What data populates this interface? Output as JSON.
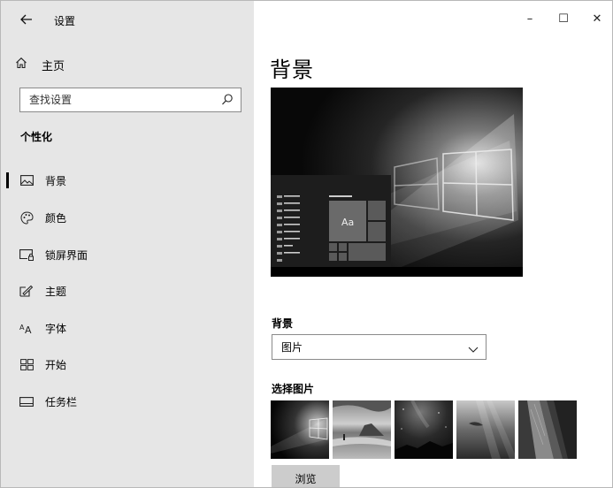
{
  "window": {
    "title": "设置",
    "controls": {
      "minimize": "–",
      "maximize": "☐",
      "close": "✕"
    }
  },
  "sidebar": {
    "back_icon": "back-arrow-icon",
    "home": {
      "label": "主页",
      "icon": "home-icon"
    },
    "search": {
      "placeholder": "查找设置",
      "icon": "search-icon"
    },
    "section_title": "个性化",
    "items": [
      {
        "label": "背景",
        "icon": "picture-icon",
        "active": true
      },
      {
        "label": "颜色",
        "icon": "palette-icon",
        "active": false
      },
      {
        "label": "锁屏界面",
        "icon": "lock-screen-icon",
        "active": false
      },
      {
        "label": "主题",
        "icon": "theme-brush-icon",
        "active": false
      },
      {
        "label": "字体",
        "icon": "font-icon",
        "active": false
      },
      {
        "label": "开始",
        "icon": "start-icon",
        "active": false
      },
      {
        "label": "任务栏",
        "icon": "taskbar-icon",
        "active": false
      }
    ]
  },
  "main": {
    "title": "背景",
    "preview": {
      "tile_text": "Aa"
    },
    "background_label": "背景",
    "background_value": "图片",
    "choose_label": "选择图片",
    "thumbnails": [
      "windows-light",
      "beach-person",
      "night-sky",
      "underwater-rays",
      "rock-texture"
    ],
    "browse_label": "浏览"
  },
  "colors": {
    "sidebar_bg": "#e6e6e6",
    "main_bg": "#ffffff",
    "button_bg": "#cccccc",
    "border": "#8a8a8a"
  }
}
